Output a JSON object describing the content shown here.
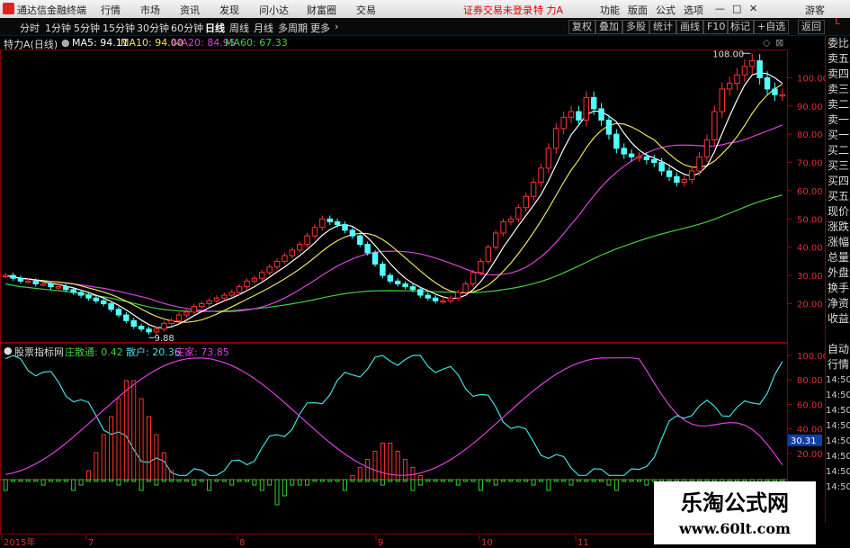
{
  "titlebar": {
    "app_title": "通达信金融终端",
    "menus": [
      "行情",
      "市场",
      "资讯",
      "发现",
      "问小达",
      "财富圈",
      "交易"
    ],
    "status": "证券交易未登录",
    "stock": "特 力A",
    "right_menus": [
      "功能",
      "版面",
      "公式",
      "选项"
    ],
    "guest": "游客"
  },
  "toolbar": {
    "periods": [
      "分时",
      "1分钟",
      "5分钟",
      "15分钟",
      "30分钟",
      "60分钟",
      "日线",
      "周线",
      "月线",
      "多周期",
      "更多"
    ],
    "active_period": "日线",
    "right_buttons": [
      "复权",
      "叠加",
      "多股",
      "统计",
      "画线",
      "F10",
      "标记",
      "+自选",
      "返回"
    ]
  },
  "toptab": "L",
  "price_panel": {
    "stock_name": "特力A(日线)",
    "ma_labels": [
      {
        "text": "MA5: 94.11",
        "color": "#ffffff"
      },
      {
        "text": "MA10: 94.00",
        "color": "#f0e060"
      },
      {
        "text": "MA20: 84.95",
        "color": "#e040e0"
      },
      {
        "text": "MA60: 67.33",
        "color": "#40d040"
      }
    ],
    "high_label": "108.00",
    "low_label": "9.88",
    "price_ticks": [
      "100.00",
      "90.00",
      "80.00",
      "70.00",
      "60.00",
      "50.00",
      "40.00",
      "30.00",
      "20.00"
    ]
  },
  "indicator_panel": {
    "name": "股票指标网",
    "labels": [
      {
        "text": "庄散通: 0.42",
        "color": "#40d040"
      },
      {
        "text": "散户: 20.36",
        "color": "#40e0e0"
      },
      {
        "text": "庄家: 73.85",
        "color": "#e040e0"
      }
    ],
    "ticks": [
      "100.00",
      "80.00",
      "60.00",
      "40.00",
      "20.00"
    ],
    "current_value": "30.31"
  },
  "right_panel": {
    "items": [
      "委比",
      "卖五",
      "卖四",
      "卖三",
      "卖二",
      "卖一",
      "买一",
      "买二",
      "买三",
      "买四",
      "买五",
      "现价",
      "涨跌",
      "涨幅",
      "总量",
      "外盘",
      "换手",
      "净资",
      "收益",
      "",
      "自动",
      "行情",
      "14:50",
      "14:50",
      "14:50",
      "14:50",
      "14:50",
      "14:50",
      "14:50",
      "14:50"
    ]
  },
  "x_axis": {
    "labels": [
      "2015年",
      "7",
      "8",
      "9",
      "10",
      "11"
    ]
  },
  "watermark": {
    "line1": "乐淘公式网",
    "line2": "www.60lt.com"
  },
  "chart_data": [
    {
      "type": "candlestick",
      "title": "特力A(日线)",
      "ylim": [
        9,
        110
      ],
      "price_ticks": [
        100,
        90,
        80,
        70,
        60,
        50,
        40,
        30,
        20
      ],
      "series": [
        {
          "name": "MA5",
          "color": "#ffffff",
          "last": 94.11
        },
        {
          "name": "MA10",
          "color": "#f0e060",
          "last": 94.0
        },
        {
          "name": "MA20",
          "color": "#e040e0",
          "last": 84.95
        },
        {
          "name": "MA60",
          "color": "#40d040",
          "last": 67.33
        }
      ],
      "annotations": [
        {
          "text": "108.00",
          "value": 108.0
        },
        {
          "text": "9.88",
          "value": 9.88
        }
      ],
      "price_path": [
        30,
        29,
        28,
        28,
        27,
        27,
        26,
        26,
        25,
        24,
        23,
        22,
        21,
        20,
        18,
        16,
        14,
        12,
        11,
        10,
        11,
        13,
        14,
        16,
        17,
        19,
        20,
        21,
        22,
        23,
        24,
        26,
        28,
        29,
        31,
        33,
        35,
        37,
        39,
        41,
        44,
        47,
        50,
        49,
        48,
        46,
        44,
        41,
        38,
        34,
        30,
        28,
        27,
        26,
        25,
        23,
        22,
        21,
        21,
        22,
        24,
        27,
        31,
        35,
        40,
        45,
        49,
        50,
        54,
        58,
        63,
        68,
        75,
        82,
        86,
        88,
        85,
        93,
        89,
        85,
        80,
        75,
        73,
        72,
        72,
        71,
        70,
        67,
        65,
        63,
        64,
        67,
        72,
        78,
        88,
        96,
        98,
        101,
        104,
        106,
        100,
        96,
        94,
        94
      ]
    },
    {
      "type": "line",
      "title": "股票指标网",
      "ylim": [
        0,
        100
      ],
      "series": [
        {
          "name": "庄散通",
          "color": "#40d040",
          "last": 0.42
        },
        {
          "name": "散户",
          "color": "#40e0e0",
          "last": 20.36
        },
        {
          "name": "庄家",
          "color": "#e040e0",
          "last": 73.85
        }
      ]
    }
  ]
}
